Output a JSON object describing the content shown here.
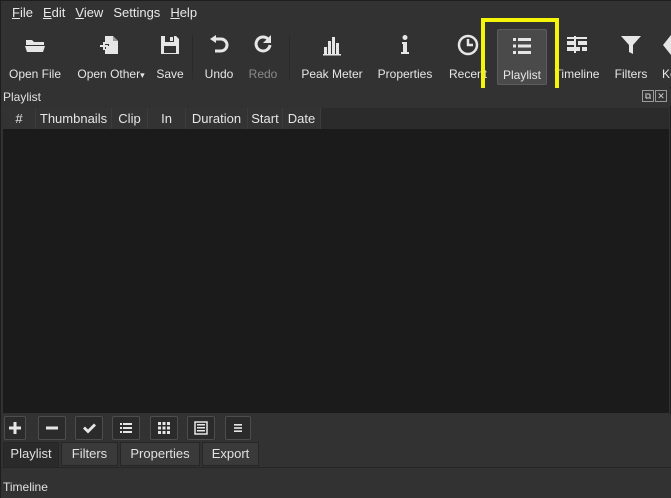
{
  "menu": [
    {
      "label": "File",
      "accel": "F",
      "rest": "ile"
    },
    {
      "label": "Edit",
      "accel": "E",
      "rest": "dit"
    },
    {
      "label": "View",
      "accel": "V",
      "rest": "iew"
    },
    {
      "label": "Settings",
      "accel": "",
      "rest": "Settings"
    },
    {
      "label": "Help",
      "accel": "H",
      "rest": "elp"
    }
  ],
  "toolbar": {
    "open_file": "Open File",
    "open_other": "Open Other",
    "save": "Save",
    "undo": "Undo",
    "redo": "Redo",
    "peak_meter": "Peak Meter",
    "properties": "Properties",
    "recent": "Recent",
    "playlist": "Playlist",
    "timeline": "Timeline",
    "filters": "Filters",
    "keyframes_partial": "Ke"
  },
  "playlist_dock": {
    "title": "Playlist",
    "columns": [
      "#",
      "Thumbnails",
      "Clip",
      "In",
      "Duration",
      "Start",
      "Date"
    ],
    "tabs": [
      "Playlist",
      "Filters",
      "Properties",
      "Export"
    ]
  },
  "timeline_dock": {
    "title": "Timeline"
  },
  "icons": {
    "add": "plus-icon",
    "remove": "minus-icon",
    "update": "check-icon",
    "details": "list-icon",
    "tiles": "grid-icon",
    "icons_view": "table-icon",
    "menu": "menu-icon"
  },
  "colors": {
    "highlight": "#f5f50a",
    "background": "#323232",
    "table_bg": "#1b1b1b"
  }
}
